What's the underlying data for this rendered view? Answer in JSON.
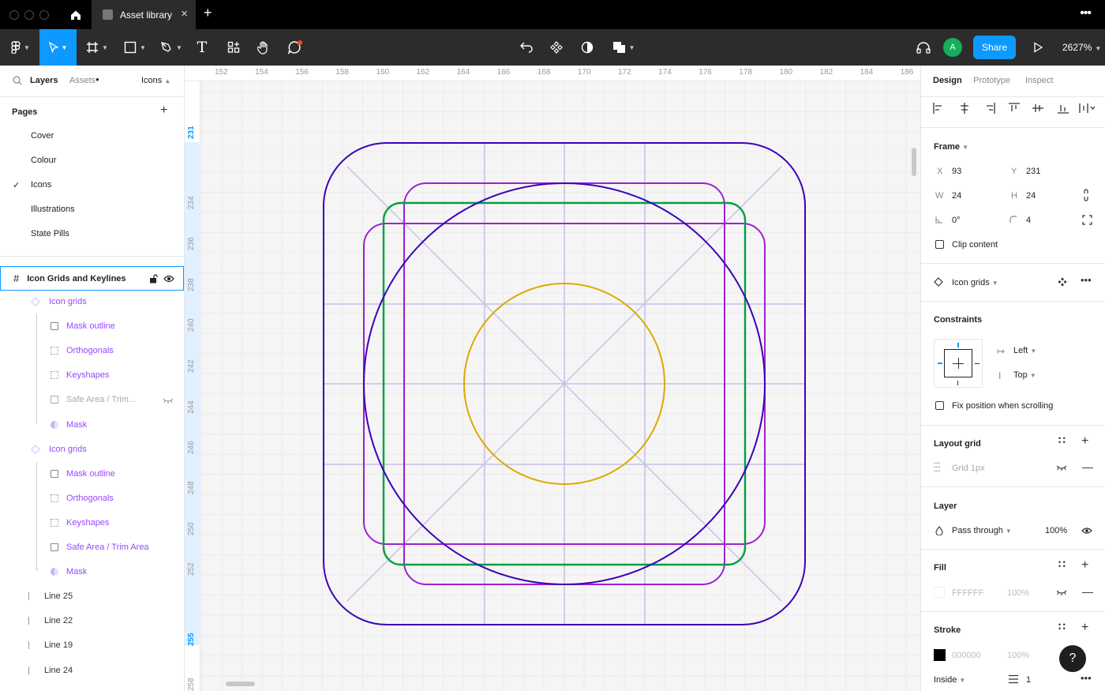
{
  "titlebar": {
    "tab_title": "Asset library",
    "close": "×",
    "new_tab": "+",
    "menu": "•••"
  },
  "toolbar": {
    "zoom": "2627%",
    "share": "Share",
    "avatar_initial": "A",
    "text_tool": "T"
  },
  "left_panel": {
    "tabs": {
      "layers": "Layers",
      "assets": "Assets",
      "page_select": "Icons"
    },
    "pages_title": "Pages",
    "pages_add": "+",
    "pages": [
      {
        "label": "Cover",
        "selected": false
      },
      {
        "label": "Colour",
        "selected": false
      },
      {
        "label": "Icons",
        "selected": true
      },
      {
        "label": "Illustrations",
        "selected": false
      },
      {
        "label": "State Pills",
        "selected": false
      }
    ],
    "check": "✓",
    "frame_name": "Icon Grids and Keylines",
    "layers": [
      {
        "label": "Icon grids",
        "indent": 1,
        "icon": "component",
        "tone": "purple"
      },
      {
        "label": "Mask outline",
        "indent": 2,
        "icon": "rect",
        "tone": "purple"
      },
      {
        "label": "Orthogonals",
        "indent": 2,
        "icon": "dashed-rect",
        "tone": "purple"
      },
      {
        "label": "Keyshapes",
        "indent": 2,
        "icon": "dashed-rect",
        "tone": "purple"
      },
      {
        "label": "Safe Area / Trim...",
        "indent": 2,
        "icon": "rect",
        "tone": "grey"
      },
      {
        "label": "Mask",
        "indent": 2,
        "icon": "mask",
        "tone": "purple"
      },
      {
        "label": "Icon grids",
        "indent": 1,
        "icon": "component",
        "tone": "purple"
      },
      {
        "label": "Mask outline",
        "indent": 2,
        "icon": "rect",
        "tone": "purple"
      },
      {
        "label": "Orthogonals",
        "indent": 2,
        "icon": "dashed-rect",
        "tone": "purple"
      },
      {
        "label": "Keyshapes",
        "indent": 2,
        "icon": "dashed-rect",
        "tone": "purple"
      },
      {
        "label": "Safe Area / Trim Area",
        "indent": 2,
        "icon": "rect",
        "tone": "purple"
      },
      {
        "label": "Mask",
        "indent": 2,
        "icon": "mask",
        "tone": "purple"
      },
      {
        "label": "Line 25",
        "indent": 1,
        "icon": "line",
        "tone": "dark"
      },
      {
        "label": "Line 22",
        "indent": 1,
        "icon": "line",
        "tone": "dark"
      },
      {
        "label": "Line 19",
        "indent": 1,
        "icon": "line",
        "tone": "dark"
      },
      {
        "label": "Line 24",
        "indent": 1,
        "icon": "line",
        "tone": "dark"
      }
    ]
  },
  "canvas": {
    "ruler_top": [
      "152",
      "154",
      "156",
      "158",
      "160",
      "162",
      "164",
      "166",
      "168",
      "170",
      "172",
      "174",
      "176",
      "178",
      "180",
      "182",
      "184",
      "186"
    ],
    "ruler_left": [
      "231",
      "234",
      "236",
      "238",
      "240",
      "242",
      "244",
      "246",
      "248",
      "250",
      "252",
      "255",
      "258"
    ],
    "ruler_left_selected": [
      "231",
      "255"
    ]
  },
  "right_panel": {
    "tabs": {
      "design": "Design",
      "prototype": "Prototype",
      "inspect": "Inspect"
    },
    "frame": {
      "title": "Frame",
      "x_label": "X",
      "x": "93",
      "y_label": "Y",
      "y": "231",
      "w_label": "W",
      "w": "24",
      "h_label": "H",
      "h": "24",
      "rotation": "0°",
      "radius": "4",
      "clip_content": "Clip content"
    },
    "component": {
      "name": "Icon grids"
    },
    "constraints": {
      "title": "Constraints",
      "horizontal": "Left",
      "vertical": "Top",
      "fix_position": "Fix position when scrolling"
    },
    "layout_grid": {
      "title": "Layout grid",
      "item": "Grid 1px"
    },
    "layer": {
      "title": "Layer",
      "blend": "Pass through",
      "opacity": "100%"
    },
    "fill": {
      "title": "Fill",
      "hex": "FFFFFF",
      "opacity": "100%"
    },
    "stroke": {
      "title": "Stroke",
      "hex": "000000",
      "opacity": "100%",
      "position": "Inside",
      "weight": "1"
    },
    "help": "?"
  },
  "colors": {
    "accent": "#0d99ff",
    "outer_square": "#3d00b8",
    "purple_rect": "#a020d0",
    "green_square": "#00a040",
    "gold_circle": "#e0a800",
    "guide": "#c6c0e6",
    "avatar": "#14ae5c"
  },
  "icons": {
    "home": "home-icon",
    "menu": "hamburger-icon",
    "move": "move-icon",
    "frame": "frame-icon",
    "shape": "rectangle-icon",
    "pen": "pen-icon",
    "text": "text-icon",
    "resources": "resources-icon",
    "hand": "hand-icon",
    "comment": "comment-icon",
    "headphones": "headphones-icon",
    "play": "play-icon"
  }
}
